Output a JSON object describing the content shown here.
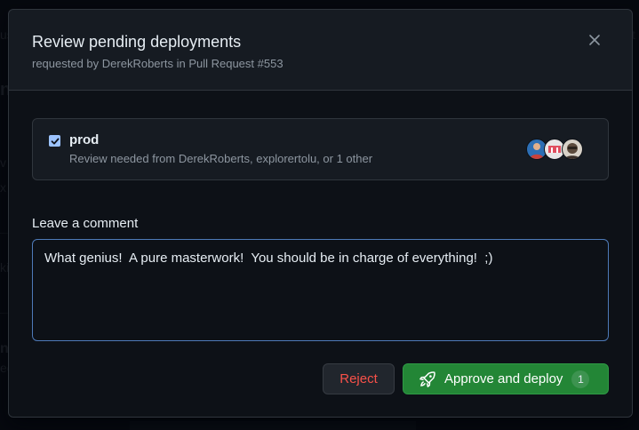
{
  "modal": {
    "title": "Review pending deployments",
    "subtitle": "requested by DerekRoberts in Pull Request #553",
    "close_icon": "close-icon"
  },
  "environment": {
    "checked": true,
    "name": "prod",
    "description": "Review needed from DerekRoberts, explorertolu, or 1 other",
    "reviewers": [
      {
        "color": "#c9413a"
      },
      {
        "color": "#e8e6e6"
      },
      {
        "color": "#5b4a3c"
      }
    ]
  },
  "comment": {
    "label": "Leave a comment",
    "value": "What genius!  A pure masterwork!  You should be in charge of everything!  ;)"
  },
  "actions": {
    "reject_label": "Reject",
    "approve_label": "Approve and deploy",
    "approve_count": "1",
    "approve_icon": "rocket-icon"
  },
  "colors": {
    "accent": "#238636",
    "danger": "#f85149",
    "focus_border": "#4e7ab8"
  }
}
